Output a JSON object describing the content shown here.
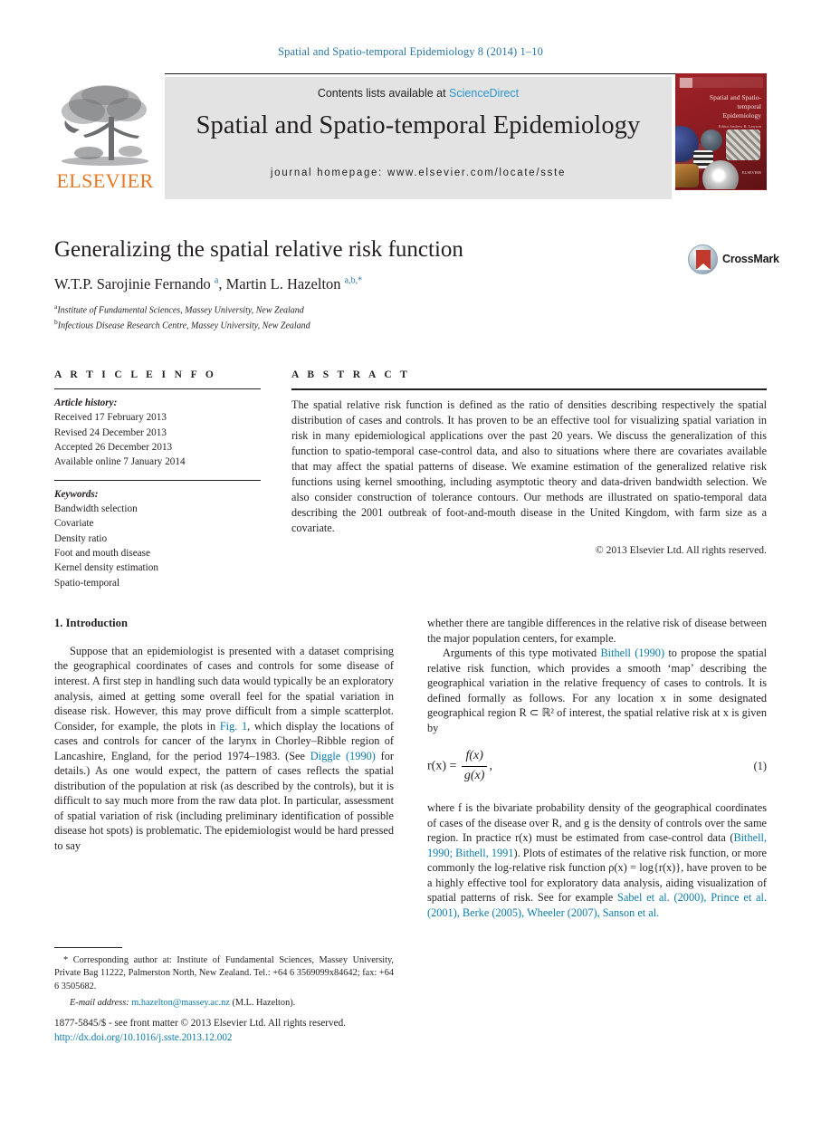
{
  "running_head": "Spatial and Spatio-temporal Epidemiology 8 (2014) 1–10",
  "masthead": {
    "contents_prefix": "Contents lists available at ",
    "sciencedirect": "ScienceDirect",
    "journal_title": "Spatial and Spatio-temporal Epidemiology",
    "homepage": "journal homepage: www.elsevier.com/locate/sste",
    "publisher_wordmark": "ELSEVIER",
    "cover": {
      "title": "Spatial and Spatio-temporal Epidemiology",
      "editors": "Editor\nAndrew B. Lawson",
      "footer": "ELSEVIER"
    },
    "accent_orange": "#e87722",
    "accent_blue": "#2b96d1",
    "panel_gray": "#e3e3e3",
    "cover_red": "#8c1d20"
  },
  "article": {
    "title": "Generalizing the spatial relative risk function",
    "authors_html": "W.T.P. Sarojinie Fernando <sup>a</sup>, Martin L. Hazelton <sup>a,b,*</sup>",
    "affiliations": [
      {
        "marker": "a",
        "text": "Institute of Fundamental Sciences, Massey University, New Zealand"
      },
      {
        "marker": "b",
        "text": "Infectious Disease Research Centre, Massey University, New Zealand"
      }
    ],
    "crossmark_label": "CrossMark"
  },
  "article_info": {
    "heading": "A R T I C L E  I N F O",
    "history_label": "Article history:",
    "history": [
      "Received 17 February 2013",
      "Revised 24 December 2013",
      "Accepted 26 December 2013",
      "Available online 7 January 2014"
    ],
    "keywords_label": "Keywords:",
    "keywords": [
      "Bandwidth selection",
      "Covariate",
      "Density ratio",
      "Foot and mouth disease",
      "Kernel density estimation",
      "Spatio-temporal"
    ]
  },
  "abstract": {
    "heading": "A B S T R A C T",
    "text": "The spatial relative risk function is defined as the ratio of densities describing respectively the spatial distribution of cases and controls. It has proven to be an effective tool for visualizing spatial variation in risk in many epidemiological applications over the past 20 years. We discuss the generalization of this function to spatio-temporal case-control data, and also to situations where there are covariates available that may affect the spatial patterns of disease. We examine estimation of the generalized relative risk functions using kernel smoothing, including asymptotic theory and data-driven bandwidth selection. We also consider construction of tolerance contours. Our methods are illustrated on spatio-temporal data describing the 2001 outbreak of foot-and-mouth disease in the United Kingdom, with farm size as a covariate.",
    "copyright": "© 2013 Elsevier Ltd. All rights reserved."
  },
  "body": {
    "section_heading": "1. Introduction",
    "left_para_1_a": "Suppose that an epidemiologist is presented with a dataset comprising the geographical coordinates of cases and controls for some disease of interest. A first step in handling such data would typically be an exploratory analysis, aimed at getting some overall feel for the spatial variation in disease risk. However, this may prove difficult from a simple scatterplot. Consider, for example, the plots in ",
    "left_ref_fig1": "Fig. 1",
    "left_para_1_b": ", which display the locations of cases and controls for cancer of the larynx in Chorley–Ribble region of Lancashire, England, for the period 1974–1983. (See ",
    "left_ref_diggle": "Diggle (1990)",
    "left_para_1_c": " for details.) As one would expect, the pattern of cases reflects the spatial distribution of the population at risk (as described by the controls), but it is difficult to say much more from the raw data plot. In particular, assessment of spatial variation of risk (including preliminary identification of possible disease hot spots) is problematic. The epidemiologist would be hard pressed to say",
    "right_para_1": "whether there are tangible differences in the relative risk of disease between the major population centers, for example.",
    "right_para_2_a": "Arguments of this type motivated ",
    "right_ref_bithell": "Bithell (1990)",
    "right_para_2_b": " to propose the spatial relative risk function, which provides a smooth ‘map’ describing the geographical variation in the relative frequency of cases to controls. It is defined formally as follows. For any location x in some designated geographical region R ⊂ ℝ² of interest, the spatial relative risk at x is given by",
    "equation": {
      "lhs": "r(x) =",
      "numerator": "f(x)",
      "denominator": "g(x)",
      "trailing": ",",
      "number": "(1)"
    },
    "right_para_3_a": "where f is the bivariate probability density of the geographical coordinates of cases of the disease over R, and g is the density of controls over the same region. In practice r(x) must be estimated from case-control data (",
    "right_ref_bithell_2": "Bithell, 1990; Bithell, 1991",
    "right_para_3_b": "). Plots of estimates of the relative risk function, or more commonly the log-relative risk function ρ(x) = log{r(x)}, have proven to be a highly effective tool for exploratory data analysis, aiding visualization of spatial patterns of risk. See for example ",
    "right_ref_list": "Sabel et al. (2000), Prince et al. (2001), Berke (2005), Wheeler (2007), Sanson et al."
  },
  "footnote": {
    "text": "* Corresponding author at: Institute of Fundamental Sciences, Massey University, Private Bag 11222, Palmerston North, New Zealand. Tel.: +64 6 3569099x84642; fax: +64 6 3505682.",
    "email_label": "E-mail address:",
    "email": "m.hazelton@massey.ac.nz",
    "email_owner": "(M.L. Hazelton)."
  },
  "footer": {
    "front_matter": "1877-5845/$ - see front matter © 2013 Elsevier Ltd. All rights reserved.",
    "doi": "http://dx.doi.org/10.1016/j.sste.2013.12.002"
  },
  "colors": {
    "link_blue": "#0b7bab",
    "head_blue": "#2a77a6",
    "text_black": "#231f20"
  }
}
